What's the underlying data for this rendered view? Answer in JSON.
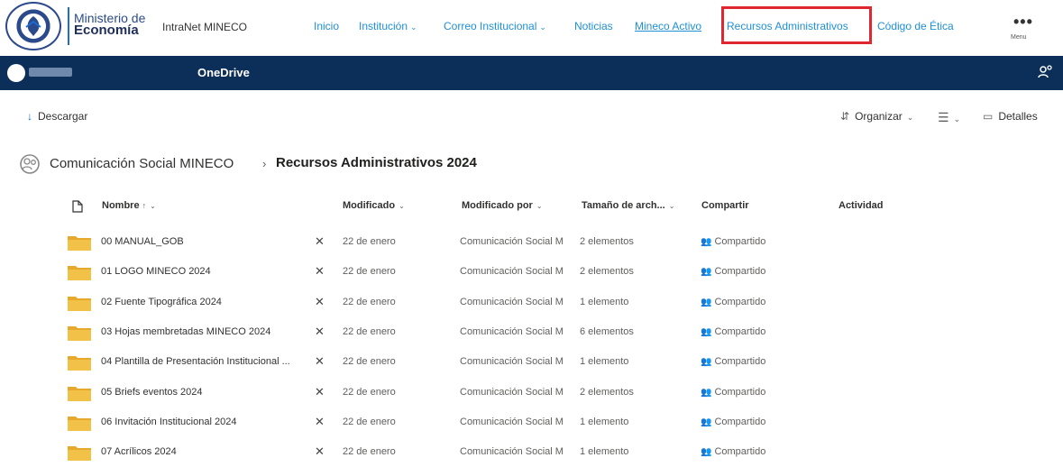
{
  "header": {
    "brand_line1": "Ministerio de",
    "brand_line2": "Economía",
    "intranet_label": "IntraNet MINECO",
    "nav": {
      "inicio": "Inicio",
      "institucion": "Institución",
      "correo": "Correo Institucional",
      "noticias": "Noticias",
      "mineco_activo": "Mineco Activo",
      "recursos": "Recursos Administrativos",
      "codigo": "Código de Ética"
    },
    "menu_label": "Menu",
    "highlight_color": "#e0262f",
    "nav_color": "#1f8fd6"
  },
  "suitebar": {
    "app_name": "OneDrive",
    "background": "#0c2f5a"
  },
  "commandbar": {
    "download": "Descargar",
    "organize": "Organizar",
    "details": "Detalles"
  },
  "breadcrumb": {
    "site": "Comunicación Social MINECO",
    "separator": "›",
    "current": "Recursos Administrativos 2024"
  },
  "table": {
    "columns": {
      "name": "Nombre",
      "sort_indicator": "↑",
      "modified": "Modificado",
      "modified_by": "Modificado por",
      "size": "Tamaño de arch...",
      "sharing": "Compartir",
      "activity": "Actividad"
    },
    "rows": [
      {
        "name": "00 MANUAL_GOB",
        "modified": "22 de enero",
        "modified_by": "Comunicación Social M",
        "size": "2 elementos",
        "sharing": "Compartido"
      },
      {
        "name": "01 LOGO MINECO 2024",
        "modified": "22 de enero",
        "modified_by": "Comunicación Social M",
        "size": "2 elementos",
        "sharing": "Compartido"
      },
      {
        "name": "02 Fuente Tipográfica 2024",
        "modified": "22 de enero",
        "modified_by": "Comunicación Social M",
        "size": "1 elemento",
        "sharing": "Compartido"
      },
      {
        "name": "03 Hojas membretadas MINECO 2024",
        "modified": "22 de enero",
        "modified_by": "Comunicación Social M",
        "size": "6 elementos",
        "sharing": "Compartido"
      },
      {
        "name": "04 Plantilla de Presentación Institucional ...",
        "modified": "22 de enero",
        "modified_by": "Comunicación Social M",
        "size": "1 elemento",
        "sharing": "Compartido"
      },
      {
        "name": "05 Briefs eventos 2024",
        "modified": "22 de enero",
        "modified_by": "Comunicación Social M",
        "size": "2 elementos",
        "sharing": "Compartido"
      },
      {
        "name": "06 Invitación Institucional 2024",
        "modified": "22 de enero",
        "modified_by": "Comunicación Social M",
        "size": "1 elemento",
        "sharing": "Compartido"
      },
      {
        "name": "07 Acrílicos 2024",
        "modified": "22 de enero",
        "modified_by": "Comunicación Social M",
        "size": "1 elemento",
        "sharing": "Compartido"
      }
    ],
    "folder_color": "#f2c248"
  }
}
